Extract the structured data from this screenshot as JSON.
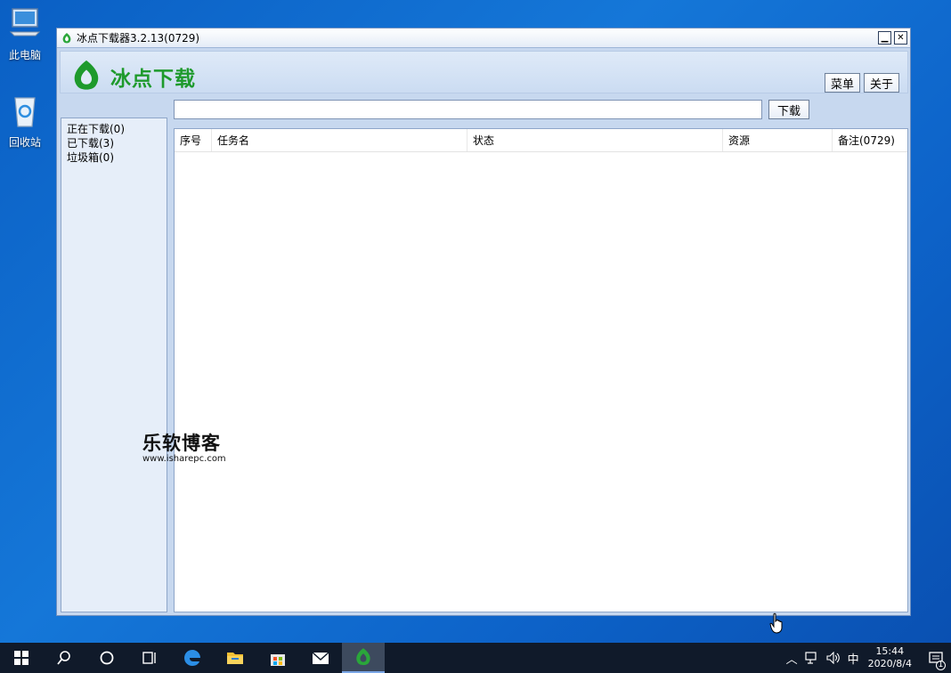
{
  "desktop": {
    "icons": [
      {
        "label": "此电脑",
        "icon": "computer-icon"
      },
      {
        "label": "回收站",
        "icon": "recycle-bin-icon"
      }
    ]
  },
  "window": {
    "title": "冰点下载器3.2.13(0729)",
    "brand": "冰点下载",
    "menu_label": "菜单",
    "about_label": "关于",
    "url_input": {
      "value": "",
      "placeholder": ""
    },
    "download_label": "下载",
    "accent_color": "#1e9a2c"
  },
  "sidebar": {
    "items": [
      {
        "label": "正在下载(0)"
      },
      {
        "label": "已下载(3)"
      },
      {
        "label": "垃圾箱(0)"
      }
    ]
  },
  "table": {
    "columns": [
      "序号",
      "任务名",
      "状态",
      "资源",
      "备注(0729)"
    ],
    "rows": []
  },
  "watermark": {
    "title": "乐软博客",
    "url": "www.isharepc.com"
  },
  "taskbar": {
    "items": [
      "windows-start-icon",
      "search-icon",
      "cortana-icon",
      "task-view-icon",
      "edge-icon",
      "file-explorer-icon",
      "store-icon",
      "mail-icon",
      "bingdian-icon"
    ],
    "tray": {
      "ime": "中",
      "time": "15:44",
      "date": "2020/8/4",
      "notification_count": "1"
    }
  }
}
